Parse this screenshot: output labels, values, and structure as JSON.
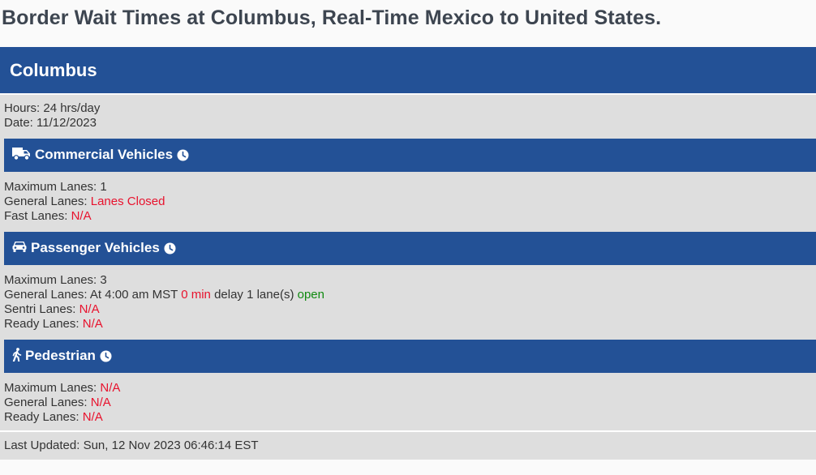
{
  "page": {
    "title": "Border Wait Times at Columbus, Real-Time Mexico to United States."
  },
  "port": {
    "name": "Columbus",
    "hours_label": "Hours:",
    "hours_value": "24 hrs/day",
    "date_label": "Date:",
    "date_value": "11/12/2023"
  },
  "commercial": {
    "title": "Commercial Vehicles",
    "icon": "truck-icon",
    "max_lanes_label": "Maximum Lanes:",
    "max_lanes_value": "1",
    "general_label": "General Lanes:",
    "general_value": "Lanes Closed",
    "fast_label": "Fast Lanes:",
    "fast_value": "N/A"
  },
  "passenger": {
    "title": "Passenger Vehicles",
    "icon": "car-icon",
    "max_lanes_label": "Maximum Lanes:",
    "max_lanes_value": "3",
    "general_label": "General Lanes:",
    "general_prefix": "At 4:00 am MST",
    "general_delay": "0 min",
    "general_middle": "delay 1 lane(s)",
    "general_status": "open",
    "sentri_label": "Sentri Lanes:",
    "sentri_value": "N/A",
    "ready_label": "Ready Lanes:",
    "ready_value": "N/A"
  },
  "pedestrian": {
    "title": "Pedestrian",
    "icon": "walking-person-icon",
    "max_lanes_label": "Maximum Lanes:",
    "max_lanes_value": "N/A",
    "general_label": "General Lanes:",
    "general_value": "N/A",
    "ready_label": "Ready Lanes:",
    "ready_value": "N/A"
  },
  "footer": {
    "last_updated_label": "Last Updated:",
    "last_updated_value": "Sun, 12 Nov 2023 06:46:14 EST"
  },
  "colors": {
    "header_blue": "#235196",
    "panel_gray": "#dedede",
    "alert_red": "#e8122d",
    "ok_green": "#108a10"
  }
}
